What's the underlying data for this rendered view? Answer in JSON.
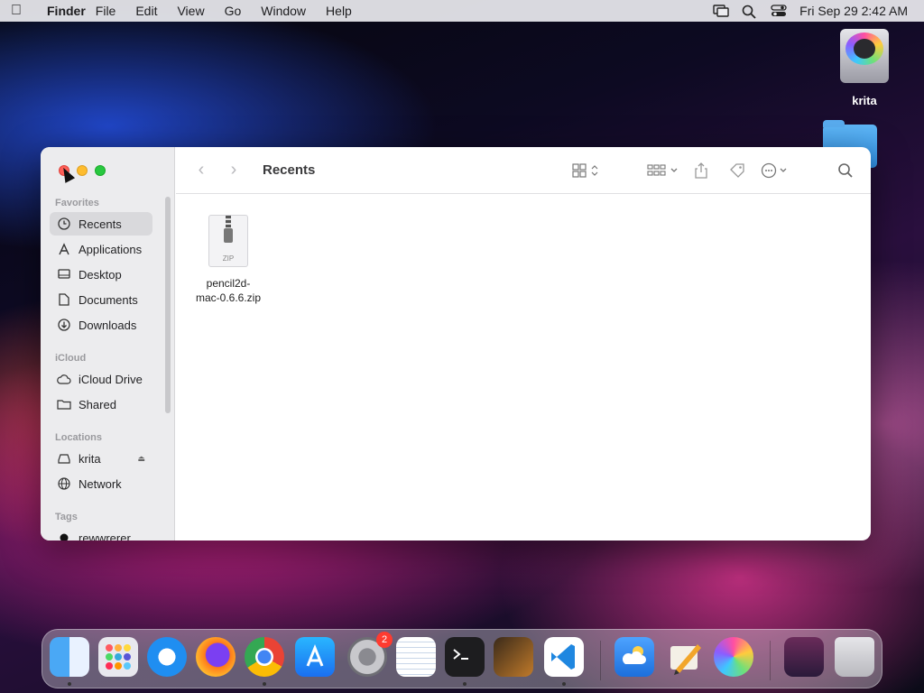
{
  "menubar": {
    "app_name": "Finder",
    "menus": [
      "File",
      "Edit",
      "View",
      "Go",
      "Window",
      "Help"
    ],
    "clock": "Fri Sep 29  2:42 AM"
  },
  "desktop": {
    "icons": [
      {
        "label": "krita"
      }
    ]
  },
  "finder": {
    "title": "Recents",
    "sidebar": {
      "favorites_header": "Favorites",
      "favorites": [
        "Recents",
        "Applications",
        "Desktop",
        "Documents",
        "Downloads"
      ],
      "icloud_header": "iCloud",
      "icloud": [
        "iCloud Drive",
        "Shared"
      ],
      "locations_header": "Locations",
      "locations": [
        "krita",
        "Network"
      ],
      "tags_header": "Tags",
      "tags": [
        "rewwrerer"
      ]
    },
    "files": [
      {
        "name_line1": "pencil2d-",
        "name_line2": "mac-0.6.6.zip",
        "type_label": "ZIP"
      }
    ]
  },
  "dock": {
    "badge_settings": "2"
  }
}
